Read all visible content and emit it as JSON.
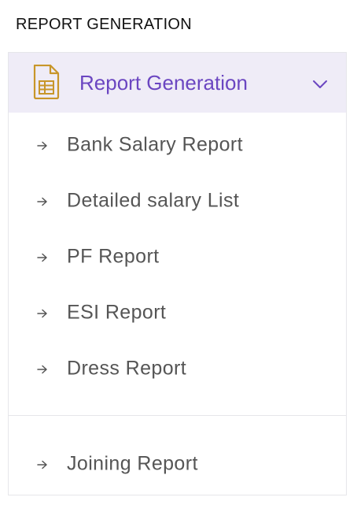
{
  "section": {
    "title": "REPORT GENERATION"
  },
  "group": {
    "label": "Report Generation",
    "icon": "spreadsheet-icon",
    "expand_icon": "chevron-down-icon",
    "accent_color": "#6b46c1",
    "icon_color": "#c8962a",
    "header_bg": "#efecf7"
  },
  "items": [
    {
      "label": "Bank Salary Report",
      "icon": "arrow-right-icon"
    },
    {
      "label": "Detailed salary List",
      "icon": "arrow-right-icon"
    },
    {
      "label": "PF Report",
      "icon": "arrow-right-icon"
    },
    {
      "label": "ESI Report",
      "icon": "arrow-right-icon"
    },
    {
      "label": "Dress Report",
      "icon": "arrow-right-icon"
    },
    {
      "label": "Joining Report",
      "icon": "arrow-right-icon"
    }
  ]
}
